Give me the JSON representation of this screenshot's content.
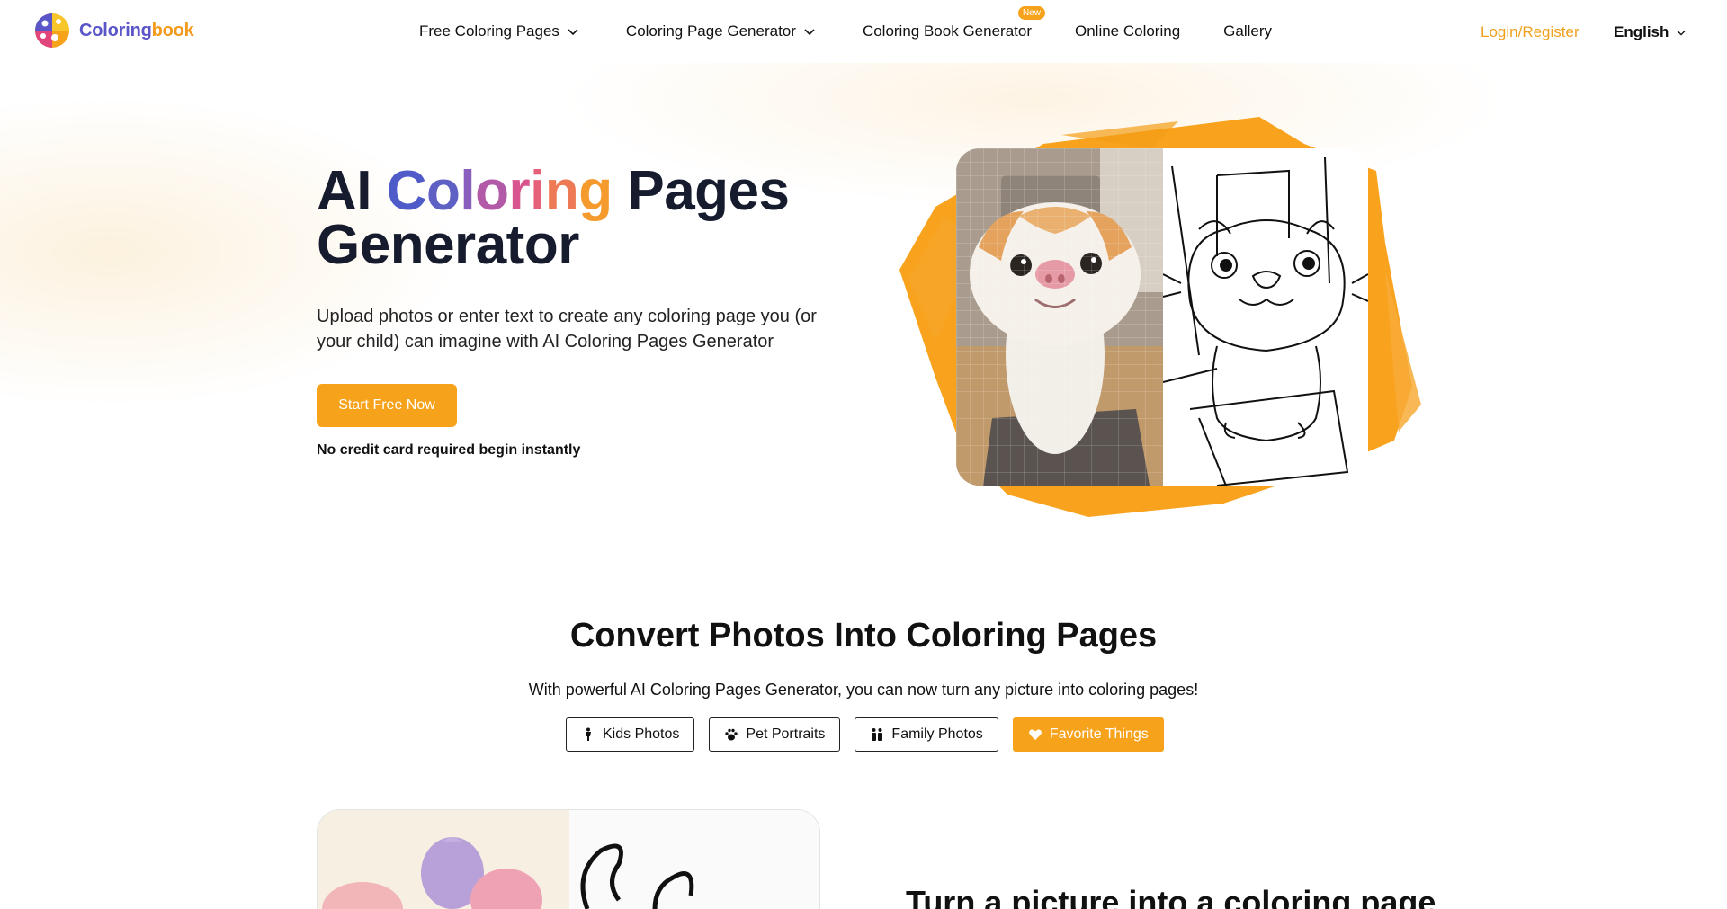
{
  "brand": {
    "name_part1": "Coloring",
    "name_part2": "book"
  },
  "nav": {
    "items": [
      {
        "label": "Free Coloring Pages",
        "has_dropdown": true
      },
      {
        "label": "Coloring Page Generator",
        "has_dropdown": true
      },
      {
        "label": "Coloring Book Generator",
        "badge": "New"
      },
      {
        "label": "Online Coloring"
      },
      {
        "label": "Gallery"
      }
    ],
    "login": "Login/Register",
    "language": "English"
  },
  "hero": {
    "title_part1": "AI ",
    "title_colored": [
      "C",
      "o",
      "l",
      "o",
      "r",
      "i",
      "n",
      "g"
    ],
    "title_part2": " Pages",
    "title_line2": "Generator",
    "subtitle": "Upload photos or enter text to create any coloring page you (or your child) can imagine with AI Coloring Pages Generator",
    "cta": "Start Free Now",
    "note": "No credit card required begin instantly"
  },
  "convert": {
    "title": "Convert Photos Into Coloring Pages",
    "subtitle": "With powerful AI Coloring Pages Generator, you can now turn any picture into coloring pages!",
    "tabs": [
      {
        "label": "Kids Photos",
        "icon": "child-icon",
        "active": false
      },
      {
        "label": "Pet Portraits",
        "icon": "paw-icon",
        "active": false
      },
      {
        "label": "Family Photos",
        "icon": "family-icon",
        "active": false
      },
      {
        "label": "Favorite Things",
        "icon": "heart-icon",
        "active": true
      }
    ]
  },
  "section3": {
    "title": "Turn a picture into a coloring page"
  },
  "colors": {
    "accent": "#f7a21b",
    "dark": "#161b2e",
    "brand_purple": "#5a55c8"
  }
}
